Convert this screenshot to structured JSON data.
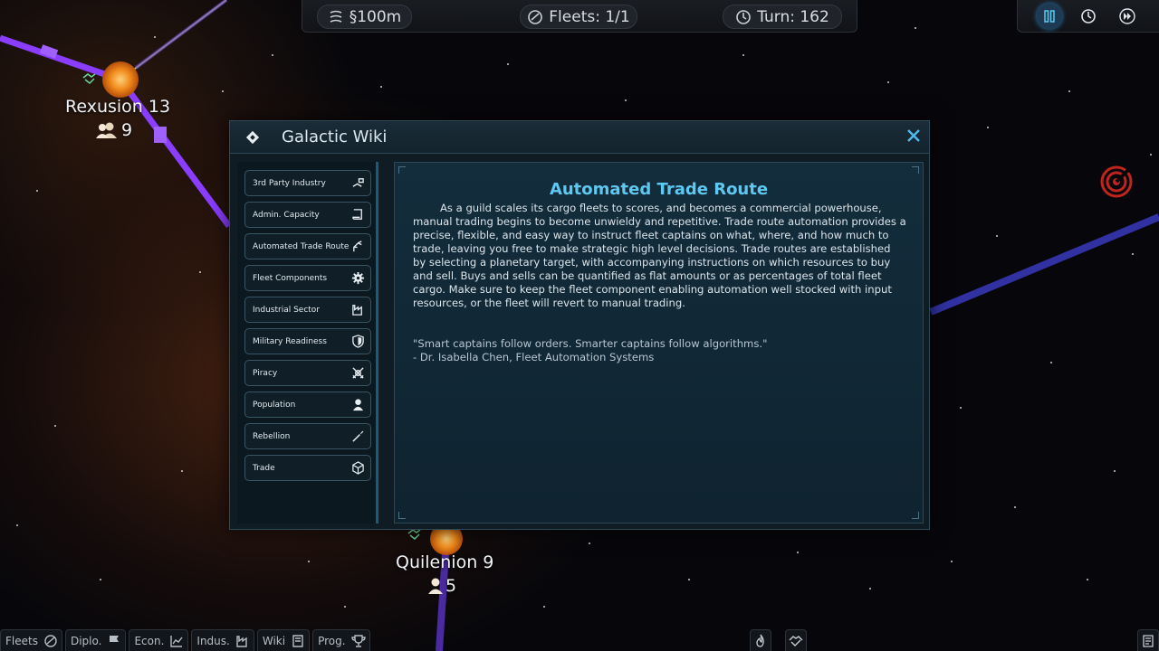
{
  "topbar": {
    "credits": "§100m",
    "fleets": "Fleets: 1/1",
    "turn": "Turn: 162"
  },
  "speed_controls": {
    "pause_active": true
  },
  "map": {
    "planets": [
      {
        "name": "Rexusion 13",
        "population": "9"
      },
      {
        "name": "Quilenion 9",
        "population": "5"
      }
    ]
  },
  "wiki": {
    "title": "Galactic Wiki",
    "close_icon": "close-icon",
    "topics": [
      {
        "label": "3rd Party Industry",
        "icon": "hand-box-icon"
      },
      {
        "label": "Admin. Capacity",
        "icon": "scroll-icon"
      },
      {
        "label": "Automated Trade Route",
        "icon": "robot-arm-icon"
      },
      {
        "label": "Fleet Components",
        "icon": "gear-icon"
      },
      {
        "label": "Industrial Sector",
        "icon": "factory-icon"
      },
      {
        "label": "Military Readiness",
        "icon": "shield-icon"
      },
      {
        "label": "Piracy",
        "icon": "crossed-swords-icon"
      },
      {
        "label": "Population",
        "icon": "person-icon"
      },
      {
        "label": "Rebellion",
        "icon": "torch-icon"
      },
      {
        "label": "Trade",
        "icon": "cube-icon"
      }
    ],
    "article": {
      "title": "Automated Trade Route",
      "body": "As a guild scales its cargo fleets to scores, and becomes a commercial powerhouse, manual trading begins to become unwieldy and repetitive. Trade route automation provides a precise, flexible, and easy way to instruct fleet captains on what, where, and how much to trade, leaving you free to make strategic high level decisions. Trade routes are established by selecting a planetary target, with accompanying instructions on which resources to buy and sell. Buys and sells can be quantified as flat amounts or as percentages of total fleet cargo. Make sure to keep the fleet component enabling automation well stocked with input resources, or the fleet will revert to manual trading.",
      "quote": "\"Smart captains follow orders. Smarter captains follow algorithms.\"",
      "quote_author": "- Dr. Isabella Chen, Fleet Automation Systems"
    }
  },
  "bottombar": {
    "tabs": [
      {
        "label": "Fleets",
        "icon": "fleet-icon"
      },
      {
        "label": "Diplo.",
        "icon": "flag-icon"
      },
      {
        "label": "Econ.",
        "icon": "chart-icon"
      },
      {
        "label": "Indus.",
        "icon": "factory-icon"
      },
      {
        "label": "Wiki",
        "icon": "book-icon"
      },
      {
        "label": "Prog.",
        "icon": "trophy-icon"
      }
    ]
  },
  "colors": {
    "accent": "#5ec8f0",
    "route": "#8a3cff",
    "planet": "#f08a1c"
  }
}
